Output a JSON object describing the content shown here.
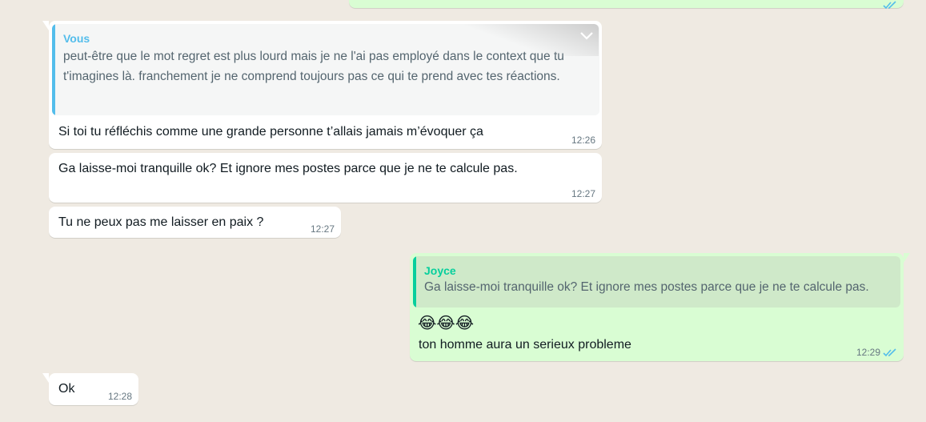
{
  "colors": {
    "chat_background": "#efeae2",
    "incoming_bubble": "#ffffff",
    "outgoing_bubble": "#d9fdd3",
    "quote_vous_accent": "#53bdeb",
    "quote_joyce_accent": "#06cf9c",
    "read_check": "#53bdeb"
  },
  "messages": [
    {
      "id": "m1",
      "direction": "in",
      "quote": {
        "author": "Vous",
        "text": "peut-être que le mot regret est plus lourd mais je ne l'ai pas employé dans le context que tu t'imagines là. franchement je ne comprend toujours pas ce qui te prend avec tes réactions."
      },
      "text": "Si toi tu réfléchis comme une grande personne t’allais jamais m’évoquer ça",
      "time": "12:26",
      "menu_icon": "chevron-down-icon"
    },
    {
      "id": "m2",
      "direction": "in",
      "text": "Ga laisse-moi tranquille ok? Et ignore mes postes parce que je ne te calcule pas.",
      "time": "12:27"
    },
    {
      "id": "m3",
      "direction": "in",
      "text": "Tu ne peux pas me laisser en paix ?",
      "time": "12:27"
    },
    {
      "id": "m4",
      "direction": "out",
      "quote": {
        "author": "Joyce",
        "text": "Ga laisse-moi tranquille ok? Et ignore mes postes parce que je ne te calcule pas."
      },
      "emoji": "😂😂😂",
      "text": "ton homme aura un serieux probleme",
      "time": "12:29",
      "status_icon": "double-check-icon"
    },
    {
      "id": "m5",
      "direction": "in",
      "text": "Ok",
      "time": "12:28"
    }
  ]
}
